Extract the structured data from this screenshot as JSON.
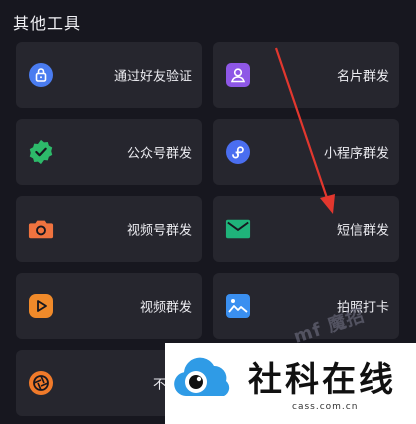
{
  "section": {
    "title": "其他工具"
  },
  "tools": [
    {
      "label": "通过好友验证",
      "icon": "lock-icon",
      "color": "#4a7cf0"
    },
    {
      "label": "名片群发",
      "icon": "contact-card-icon",
      "color": "#8e57e6"
    },
    {
      "label": "公众号群发",
      "icon": "verified-badge-icon",
      "color": "#2dba6a"
    },
    {
      "label": "小程序群发",
      "icon": "mini-program-icon",
      "color": "#4a6ef0"
    },
    {
      "label": "视频号群发",
      "icon": "camera-icon",
      "color": "#f0733f"
    },
    {
      "label": "短信群发",
      "icon": "envelope-icon",
      "color": "#1fb37a"
    },
    {
      "label": "视频群发",
      "icon": "play-icon",
      "color": "#f08a2a"
    },
    {
      "label": "拍照打卡",
      "icon": "photo-icon",
      "color": "#3a8ff0"
    },
    {
      "label": "不折叠",
      "icon": "aperture-icon",
      "color": "#f07a2a"
    }
  ],
  "watermark": {
    "name": "社科在线",
    "domain": "cass.com.cn",
    "ghost": "mf 魔招"
  },
  "annotation": {
    "arrow_color": "#e2372e"
  }
}
